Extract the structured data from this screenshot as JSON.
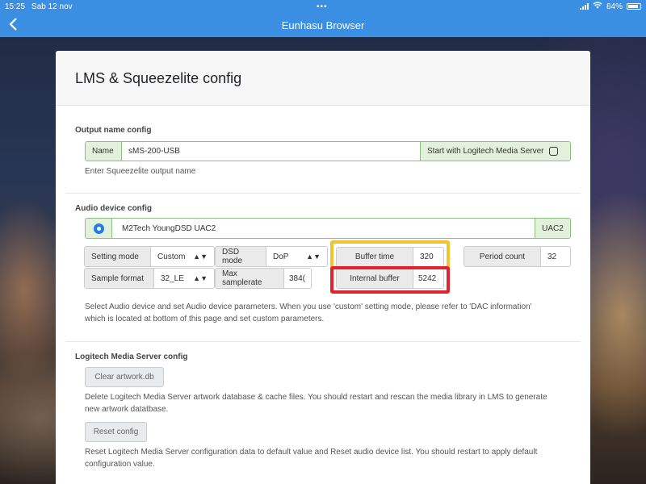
{
  "status_bar": {
    "time": "15:25",
    "date": "Sab 12 nov",
    "battery": "84%",
    "battery_level": 0.84
  },
  "nav": {
    "title": "Eunhasu Browser",
    "back_icon": "chevron-left-icon"
  },
  "page_title": "LMS & Squeezelite config",
  "output": {
    "section_title": "Output name config",
    "name_label": "Name",
    "name_value": "sMS-200-USB",
    "start_lms_label": "Start with Logitech Media Server",
    "help": "Enter Squeezelite output name"
  },
  "audio": {
    "section_title": "Audio device config",
    "device_name": "M2Tech YoungDSD UAC2",
    "device_tag": "UAC2",
    "setting_mode_label": "Setting mode",
    "setting_mode_value": "Custom",
    "dsd_mode_label": "DSD mode",
    "dsd_mode_value": "DoP",
    "buffer_time_label": "Buffer time",
    "buffer_time_value": "320",
    "period_count_label": "Period count",
    "period_count_value": "32",
    "sample_format_label": "Sample format",
    "sample_format_value": "32_LE",
    "max_samplerate_label": "Max samplerate",
    "max_samplerate_value": "384(",
    "internal_buffer_label": "Internal buffer",
    "internal_buffer_value": "5242",
    "help_line1": "Select Audio device and set Audio device parameters. When you use 'custom' setting mode, please refer to 'DAC information'",
    "help_line2": "which is located at bottom of this page and set custom parameters."
  },
  "lms": {
    "section_title": "Logitech Media Server config",
    "clear_label": "Clear artwork.db",
    "clear_help_line1": "Delete Logitech Media Server artwork database & cache files. You should restart and rescan the media library in LMS to generate",
    "clear_help_line2": "new artwork datatbase.",
    "reset_label": "Reset config",
    "reset_help_line1": "Reset Logitech Media Server configuration data to default value and Reset audio device list. You should restart to apply default",
    "reset_help_line2": "configuration value."
  },
  "colors": {
    "accent": "#3b8fe3",
    "highlight_yellow": "#f2c230",
    "highlight_red": "#e2232b",
    "group_green": "#8cbf80"
  }
}
